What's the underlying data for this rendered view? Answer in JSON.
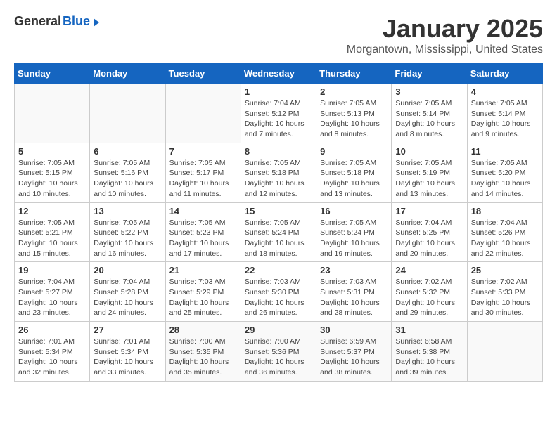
{
  "header": {
    "logo_general": "General",
    "logo_blue": "Blue",
    "month_title": "January 2025",
    "location": "Morgantown, Mississippi, United States"
  },
  "days_of_week": [
    "Sunday",
    "Monday",
    "Tuesday",
    "Wednesday",
    "Thursday",
    "Friday",
    "Saturday"
  ],
  "weeks": [
    [
      {
        "day": "",
        "info": ""
      },
      {
        "day": "",
        "info": ""
      },
      {
        "day": "",
        "info": ""
      },
      {
        "day": "1",
        "info": "Sunrise: 7:04 AM\nSunset: 5:12 PM\nDaylight: 10 hours\nand 7 minutes."
      },
      {
        "day": "2",
        "info": "Sunrise: 7:05 AM\nSunset: 5:13 PM\nDaylight: 10 hours\nand 8 minutes."
      },
      {
        "day": "3",
        "info": "Sunrise: 7:05 AM\nSunset: 5:14 PM\nDaylight: 10 hours\nand 8 minutes."
      },
      {
        "day": "4",
        "info": "Sunrise: 7:05 AM\nSunset: 5:14 PM\nDaylight: 10 hours\nand 9 minutes."
      }
    ],
    [
      {
        "day": "5",
        "info": "Sunrise: 7:05 AM\nSunset: 5:15 PM\nDaylight: 10 hours\nand 10 minutes."
      },
      {
        "day": "6",
        "info": "Sunrise: 7:05 AM\nSunset: 5:16 PM\nDaylight: 10 hours\nand 10 minutes."
      },
      {
        "day": "7",
        "info": "Sunrise: 7:05 AM\nSunset: 5:17 PM\nDaylight: 10 hours\nand 11 minutes."
      },
      {
        "day": "8",
        "info": "Sunrise: 7:05 AM\nSunset: 5:18 PM\nDaylight: 10 hours\nand 12 minutes."
      },
      {
        "day": "9",
        "info": "Sunrise: 7:05 AM\nSunset: 5:18 PM\nDaylight: 10 hours\nand 13 minutes."
      },
      {
        "day": "10",
        "info": "Sunrise: 7:05 AM\nSunset: 5:19 PM\nDaylight: 10 hours\nand 13 minutes."
      },
      {
        "day": "11",
        "info": "Sunrise: 7:05 AM\nSunset: 5:20 PM\nDaylight: 10 hours\nand 14 minutes."
      }
    ],
    [
      {
        "day": "12",
        "info": "Sunrise: 7:05 AM\nSunset: 5:21 PM\nDaylight: 10 hours\nand 15 minutes."
      },
      {
        "day": "13",
        "info": "Sunrise: 7:05 AM\nSunset: 5:22 PM\nDaylight: 10 hours\nand 16 minutes."
      },
      {
        "day": "14",
        "info": "Sunrise: 7:05 AM\nSunset: 5:23 PM\nDaylight: 10 hours\nand 17 minutes."
      },
      {
        "day": "15",
        "info": "Sunrise: 7:05 AM\nSunset: 5:24 PM\nDaylight: 10 hours\nand 18 minutes."
      },
      {
        "day": "16",
        "info": "Sunrise: 7:05 AM\nSunset: 5:24 PM\nDaylight: 10 hours\nand 19 minutes."
      },
      {
        "day": "17",
        "info": "Sunrise: 7:04 AM\nSunset: 5:25 PM\nDaylight: 10 hours\nand 20 minutes."
      },
      {
        "day": "18",
        "info": "Sunrise: 7:04 AM\nSunset: 5:26 PM\nDaylight: 10 hours\nand 22 minutes."
      }
    ],
    [
      {
        "day": "19",
        "info": "Sunrise: 7:04 AM\nSunset: 5:27 PM\nDaylight: 10 hours\nand 23 minutes."
      },
      {
        "day": "20",
        "info": "Sunrise: 7:04 AM\nSunset: 5:28 PM\nDaylight: 10 hours\nand 24 minutes."
      },
      {
        "day": "21",
        "info": "Sunrise: 7:03 AM\nSunset: 5:29 PM\nDaylight: 10 hours\nand 25 minutes."
      },
      {
        "day": "22",
        "info": "Sunrise: 7:03 AM\nSunset: 5:30 PM\nDaylight: 10 hours\nand 26 minutes."
      },
      {
        "day": "23",
        "info": "Sunrise: 7:03 AM\nSunset: 5:31 PM\nDaylight: 10 hours\nand 28 minutes."
      },
      {
        "day": "24",
        "info": "Sunrise: 7:02 AM\nSunset: 5:32 PM\nDaylight: 10 hours\nand 29 minutes."
      },
      {
        "day": "25",
        "info": "Sunrise: 7:02 AM\nSunset: 5:33 PM\nDaylight: 10 hours\nand 30 minutes."
      }
    ],
    [
      {
        "day": "26",
        "info": "Sunrise: 7:01 AM\nSunset: 5:34 PM\nDaylight: 10 hours\nand 32 minutes."
      },
      {
        "day": "27",
        "info": "Sunrise: 7:01 AM\nSunset: 5:34 PM\nDaylight: 10 hours\nand 33 minutes."
      },
      {
        "day": "28",
        "info": "Sunrise: 7:00 AM\nSunset: 5:35 PM\nDaylight: 10 hours\nand 35 minutes."
      },
      {
        "day": "29",
        "info": "Sunrise: 7:00 AM\nSunset: 5:36 PM\nDaylight: 10 hours\nand 36 minutes."
      },
      {
        "day": "30",
        "info": "Sunrise: 6:59 AM\nSunset: 5:37 PM\nDaylight: 10 hours\nand 38 minutes."
      },
      {
        "day": "31",
        "info": "Sunrise: 6:58 AM\nSunset: 5:38 PM\nDaylight: 10 hours\nand 39 minutes."
      },
      {
        "day": "",
        "info": ""
      }
    ]
  ]
}
